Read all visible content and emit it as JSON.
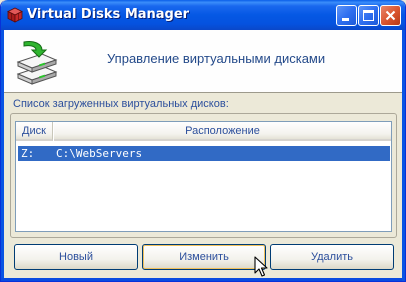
{
  "window": {
    "title": "Virtual Disks Manager"
  },
  "header": {
    "title": "Управление виртуальными дисками"
  },
  "list": {
    "label": "Список загруженных виртуальных дисков:",
    "columns": [
      "Диск",
      "Расположение"
    ],
    "rows": [
      {
        "disk": "Z:",
        "path": "C:\\WebServers",
        "selected": true
      }
    ]
  },
  "buttons": {
    "new": "Новый",
    "edit": "Изменить",
    "delete": "Удалить"
  },
  "icons": {
    "app": "red-cube-icon",
    "header": "disk-drive-arrow-icon",
    "minimize": "minimize-icon",
    "maximize": "maximize-icon",
    "close": "close-icon",
    "cursor": "mouse-pointer-icon"
  },
  "colors": {
    "selection": "#316ac5",
    "titlebar": "#0558e4",
    "close": "#d9532d"
  }
}
